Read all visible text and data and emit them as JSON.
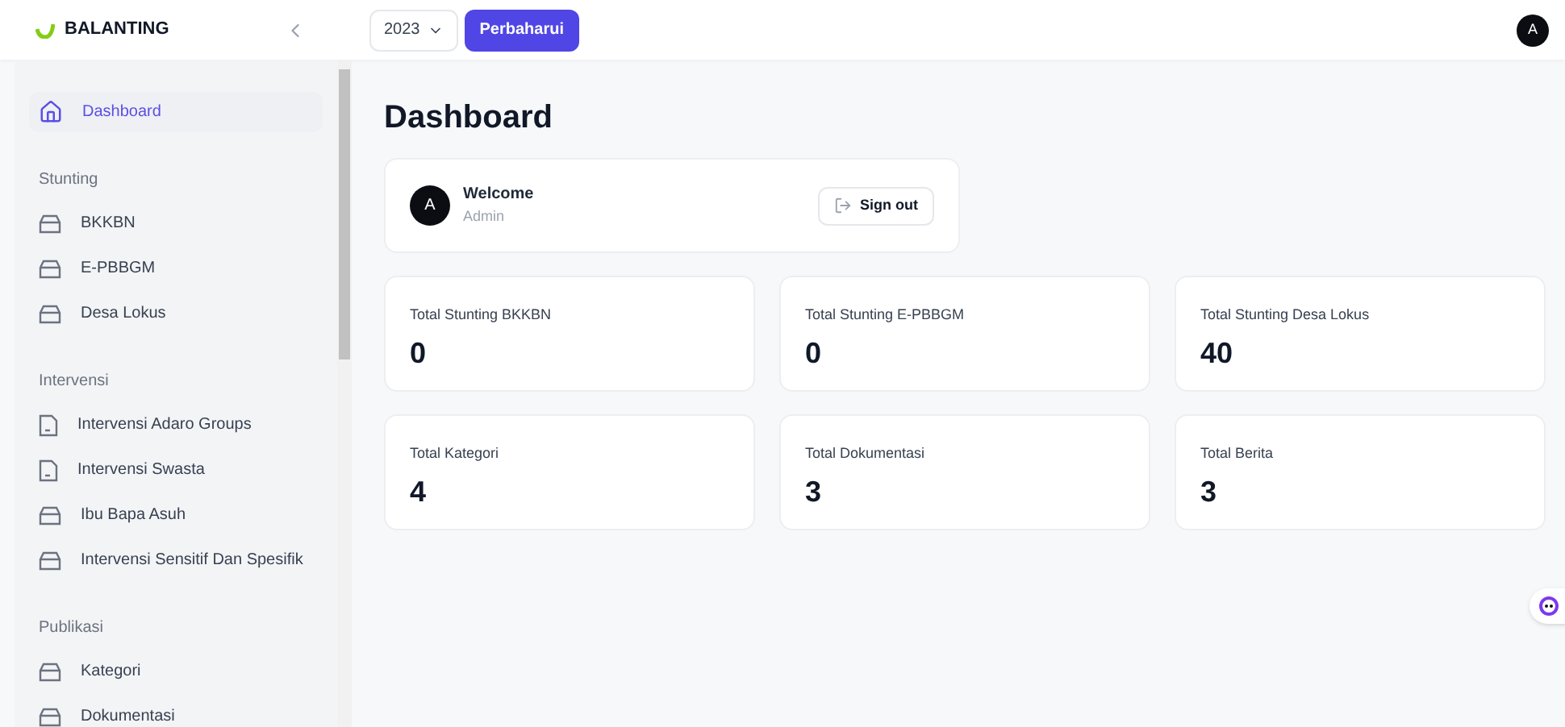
{
  "brand": {
    "name": "BALANTING"
  },
  "header": {
    "year": "2023",
    "update_button": "Perbaharui",
    "avatar": "A"
  },
  "sidebar": {
    "items": [
      {
        "label": "Dashboard",
        "kind": "home",
        "selected": true
      }
    ],
    "sections": [
      {
        "title": "Stunting",
        "items": [
          {
            "label": "BKKBN",
            "kind": "tray",
            "selected": false
          },
          {
            "label": "E-PBBGM",
            "kind": "tray",
            "selected": false
          },
          {
            "label": "Desa Lokus",
            "kind": "tray",
            "selected": false
          }
        ]
      },
      {
        "title": "Intervensi",
        "items": [
          {
            "label": "Intervensi Adaro Groups",
            "kind": "file",
            "selected": false
          },
          {
            "label": "Intervensi Swasta",
            "kind": "file",
            "selected": false
          },
          {
            "label": "Ibu Bapa Asuh",
            "kind": "tray",
            "selected": false
          },
          {
            "label": "Intervensi Sensitif Dan Spesifik",
            "kind": "tray",
            "selected": false
          }
        ]
      },
      {
        "title": "Publikasi",
        "items": [
          {
            "label": "Kategori",
            "kind": "tray",
            "selected": false
          },
          {
            "label": "Dokumentasi",
            "kind": "tray",
            "selected": false
          }
        ]
      }
    ]
  },
  "page": {
    "title": "Dashboard"
  },
  "welcome": {
    "avatar": "A",
    "title": "Welcome",
    "subtitle": "Admin",
    "sign_out": "Sign out"
  },
  "stats": [
    {
      "label": "Total Stunting BKKBN",
      "value": "0"
    },
    {
      "label": "Total Stunting E-PBBGM",
      "value": "0"
    },
    {
      "label": "Total Stunting Desa Lokus",
      "value": "40"
    },
    {
      "label": "Total Kategori",
      "value": "4"
    },
    {
      "label": "Total Dokumentasi",
      "value": "3"
    },
    {
      "label": "Total Berita",
      "value": "3"
    }
  ]
}
